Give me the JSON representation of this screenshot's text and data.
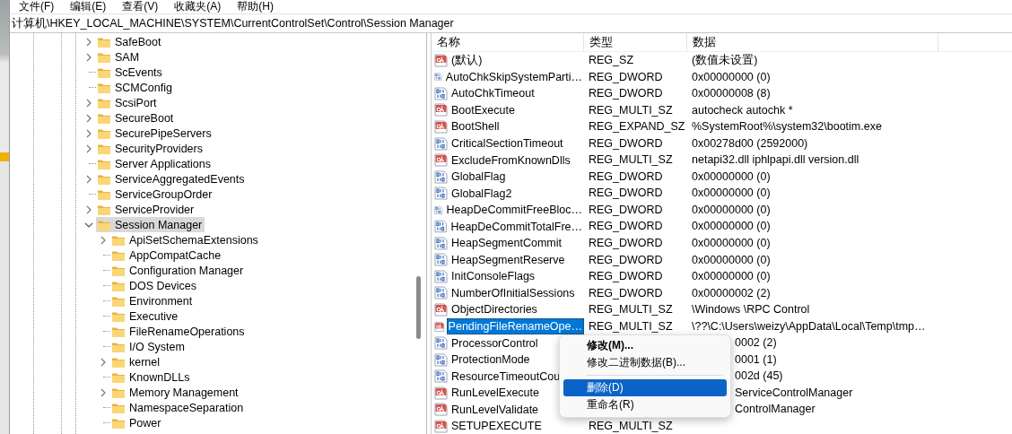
{
  "menu_bar": [
    "文件(F)",
    "编辑(E)",
    "查看(V)",
    "收藏夹(A)",
    "帮助(H)"
  ],
  "address": "计算机\\HKEY_LOCAL_MACHINE\\SYSTEM\\CurrentControlSet\\Control\\Session Manager",
  "tree": [
    {
      "label": "SafeBoot",
      "expandable": true,
      "expanded": false,
      "selected": false
    },
    {
      "label": "SAM",
      "expandable": true,
      "expanded": false,
      "selected": false
    },
    {
      "label": "ScEvents",
      "expandable": false,
      "selected": false
    },
    {
      "label": "SCMConfig",
      "expandable": false,
      "selected": false
    },
    {
      "label": "ScsiPort",
      "expandable": true,
      "expanded": false,
      "selected": false
    },
    {
      "label": "SecureBoot",
      "expandable": true,
      "expanded": false,
      "selected": false
    },
    {
      "label": "SecurePipeServers",
      "expandable": true,
      "expanded": false,
      "selected": false
    },
    {
      "label": "SecurityProviders",
      "expandable": true,
      "expanded": false,
      "selected": false
    },
    {
      "label": "Server Applications",
      "expandable": false,
      "selected": false
    },
    {
      "label": "ServiceAggregatedEvents",
      "expandable": true,
      "expanded": false,
      "selected": false
    },
    {
      "label": "ServiceGroupOrder",
      "expandable": false,
      "selected": false
    },
    {
      "label": "ServiceProvider",
      "expandable": true,
      "expanded": false,
      "selected": false
    },
    {
      "label": "Session Manager",
      "expandable": true,
      "expanded": true,
      "selected": true,
      "children": [
        {
          "label": "ApiSetSchemaExtensions",
          "expandable": true,
          "expanded": false,
          "selected": false
        },
        {
          "label": "AppCompatCache",
          "expandable": false,
          "selected": false
        },
        {
          "label": "Configuration Manager",
          "expandable": false,
          "selected": false
        },
        {
          "label": "DOS Devices",
          "expandable": false,
          "selected": false
        },
        {
          "label": "Environment",
          "expandable": false,
          "selected": false
        },
        {
          "label": "Executive",
          "expandable": false,
          "selected": false
        },
        {
          "label": "FileRenameOperations",
          "expandable": false,
          "selected": false
        },
        {
          "label": "I/O System",
          "expandable": false,
          "selected": false
        },
        {
          "label": "kernel",
          "expandable": true,
          "expanded": false,
          "selected": false
        },
        {
          "label": "KnownDLLs",
          "expandable": false,
          "selected": false
        },
        {
          "label": "Memory Management",
          "expandable": true,
          "expanded": false,
          "selected": false
        },
        {
          "label": "NamespaceSeparation",
          "expandable": false,
          "selected": false
        },
        {
          "label": "Power",
          "expandable": false,
          "selected": false
        }
      ]
    }
  ],
  "values": {
    "columns": [
      "名称",
      "类型",
      "数据"
    ],
    "rows": [
      {
        "kind": "string",
        "name": "(默认)",
        "type": "REG_SZ",
        "data": "(数值未设置)",
        "selected": false
      },
      {
        "kind": "binary",
        "name": "AutoChkSkipSystemParti…",
        "type": "REG_DWORD",
        "data": "0x00000000 (0)",
        "selected": false
      },
      {
        "kind": "binary",
        "name": "AutoChkTimeout",
        "type": "REG_DWORD",
        "data": "0x00000008 (8)",
        "selected": false
      },
      {
        "kind": "string",
        "name": "BootExecute",
        "type": "REG_MULTI_SZ",
        "data": "autocheck autochk *",
        "selected": false
      },
      {
        "kind": "string",
        "name": "BootShell",
        "type": "REG_EXPAND_SZ",
        "data": "%SystemRoot%\\system32\\bootim.exe",
        "selected": false
      },
      {
        "kind": "binary",
        "name": "CriticalSectionTimeout",
        "type": "REG_DWORD",
        "data": "0x00278d00 (2592000)",
        "selected": false
      },
      {
        "kind": "string",
        "name": "ExcludeFromKnownDlls",
        "type": "REG_MULTI_SZ",
        "data": "netapi32.dll iphlpapi.dll version.dll",
        "selected": false
      },
      {
        "kind": "binary",
        "name": "GlobalFlag",
        "type": "REG_DWORD",
        "data": "0x00000000 (0)",
        "selected": false
      },
      {
        "kind": "binary",
        "name": "GlobalFlag2",
        "type": "REG_DWORD",
        "data": "0x00000000 (0)",
        "selected": false
      },
      {
        "kind": "binary",
        "name": "HeapDeCommitFreeBloc…",
        "type": "REG_DWORD",
        "data": "0x00000000 (0)",
        "selected": false
      },
      {
        "kind": "binary",
        "name": "HeapDeCommitTotalFre…",
        "type": "REG_DWORD",
        "data": "0x00000000 (0)",
        "selected": false
      },
      {
        "kind": "binary",
        "name": "HeapSegmentCommit",
        "type": "REG_DWORD",
        "data": "0x00000000 (0)",
        "selected": false
      },
      {
        "kind": "binary",
        "name": "HeapSegmentReserve",
        "type": "REG_DWORD",
        "data": "0x00000000 (0)",
        "selected": false
      },
      {
        "kind": "binary",
        "name": "InitConsoleFlags",
        "type": "REG_DWORD",
        "data": "0x00000000 (0)",
        "selected": false
      },
      {
        "kind": "binary",
        "name": "NumberOfInitialSessions",
        "type": "REG_DWORD",
        "data": "0x00000002 (2)",
        "selected": false
      },
      {
        "kind": "string",
        "name": "ObjectDirectories",
        "type": "REG_MULTI_SZ",
        "data": "\\Windows \\RPC Control",
        "selected": false
      },
      {
        "kind": "string",
        "name": "PendingFileRenameOpe…",
        "type": "REG_MULTI_SZ",
        "data": "\\??\\C:\\Users\\weizy\\AppData\\Local\\Temp\\tmp…",
        "selected": true
      },
      {
        "kind": "binary",
        "name": "ProcessorControl",
        "data": "0002 (2)",
        "covered": true,
        "selected": false
      },
      {
        "kind": "binary",
        "name": "ProtectionMode",
        "data": "0001 (1)",
        "covered": true,
        "selected": false
      },
      {
        "kind": "binary",
        "name": "ResourceTimeoutCou",
        "data": "002d (45)",
        "covered": true,
        "selected": false
      },
      {
        "kind": "string",
        "name": "RunLevelExecute",
        "data": "ServiceControlManager",
        "covered": true,
        "selected": false
      },
      {
        "kind": "string",
        "name": "RunLevelValidate",
        "data": "ControlManager",
        "covered": true,
        "selected": false
      },
      {
        "kind": "string",
        "name": "SETUPEXECUTE",
        "type": "REG_MULTI_SZ",
        "selected": false
      }
    ]
  },
  "context_menu": [
    {
      "kind": "item",
      "label": "修改(M)...",
      "default": true,
      "selected": false
    },
    {
      "kind": "item",
      "label": "修改二进制数据(B)...",
      "default": false,
      "selected": false
    },
    {
      "kind": "separator"
    },
    {
      "kind": "item",
      "label": "删除(D)",
      "default": false,
      "selected": true
    },
    {
      "kind": "item",
      "label": "重命名(R)",
      "default": false,
      "selected": false
    }
  ]
}
